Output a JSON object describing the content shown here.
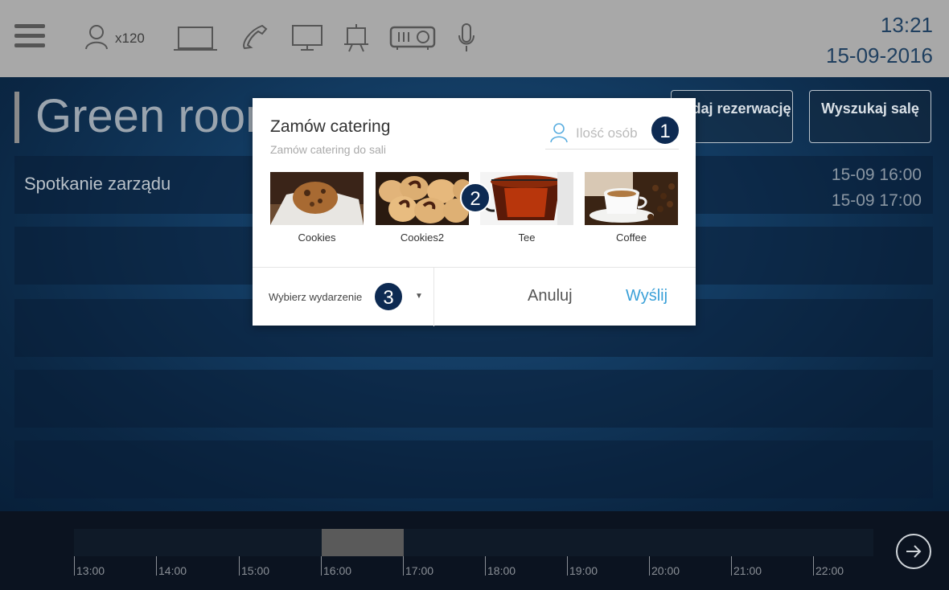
{
  "topbar": {
    "capacity": "x120",
    "icons": [
      "menu-icon",
      "person-icon",
      "laptop-icon",
      "phone-icon",
      "monitor-icon",
      "flipchart-icon",
      "projector-icon",
      "microphone-icon"
    ],
    "time": "13:21",
    "date": "15-09-2016"
  },
  "room": {
    "title": "Green room",
    "add_reservation_label": "Dodaj rezerwację",
    "search_room_label": "Wyszukaj salę"
  },
  "events": [
    {
      "title": "Spotkanie zarządu",
      "start": "15-09 16:00",
      "end": "15-09 17:00"
    }
  ],
  "modal": {
    "title": "Zamów catering",
    "subtitle": "Zamów catering do sali",
    "people_placeholder": "Ilość osób",
    "items": [
      {
        "label": "Cookies"
      },
      {
        "label": "Cookies2"
      },
      {
        "label": "Tee"
      },
      {
        "label": "Coffee"
      }
    ],
    "event_select_label": "Wybierz wydarzenie",
    "cancel_label": "Anuluj",
    "send_label": "Wyślij"
  },
  "badges": [
    "1",
    "2",
    "3"
  ],
  "timeline": {
    "ticks": [
      "13:00",
      "14:00",
      "15:00",
      "16:00",
      "17:00",
      "18:00",
      "19:00",
      "20:00",
      "21:00",
      "22:00"
    ],
    "selection": {
      "start": "16:00",
      "end": "17:00"
    }
  },
  "colors": {
    "topbar_bg": "#a8a8a8",
    "clock": "#1f3f5f",
    "accent": "#3aa0d8",
    "badge": "#0d2a52"
  }
}
